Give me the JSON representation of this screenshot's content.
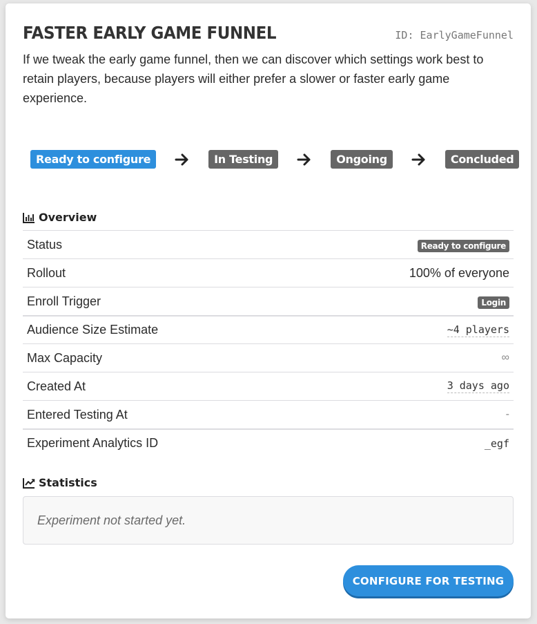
{
  "experiment": {
    "title": "FASTER EARLY GAME FUNNEL",
    "id_label": "ID: EarlyGameFunnel",
    "hypothesis": "If we tweak the early game funnel, then we can discover which settings work best to retain players, because players will either prefer a slower or faster early game experience."
  },
  "pipeline": {
    "stages": [
      {
        "label": "Ready to configure",
        "active": true
      },
      {
        "label": "In Testing",
        "active": false
      },
      {
        "label": "Ongoing",
        "active": false
      },
      {
        "label": "Concluded",
        "active": false
      }
    ],
    "active_color": "#2d8fdd",
    "inactive_color": "#666666"
  },
  "overview": {
    "title": "Overview",
    "icon": "bar-chart-icon",
    "rows": [
      {
        "label": "Status",
        "value": "Ready to configure"
      },
      {
        "label": "Rollout",
        "value": "100% of everyone"
      },
      {
        "label": "Enroll Trigger",
        "value": "Login"
      },
      {
        "label": "Audience Size Estimate",
        "value": "~4 players"
      },
      {
        "label": "Max Capacity",
        "value": "∞"
      },
      {
        "label": "Created At",
        "value": "3 days ago"
      },
      {
        "label": "Entered Testing At",
        "value": "-"
      },
      {
        "label": "Experiment Analytics ID",
        "value": "_egf"
      }
    ]
  },
  "statistics": {
    "title": "Statistics",
    "icon": "line-chart-icon",
    "empty_message": "Experiment not started yet."
  },
  "actions": {
    "configure_label": "CONFIGURE FOR TESTING",
    "button_color": "#2d8fdd"
  }
}
